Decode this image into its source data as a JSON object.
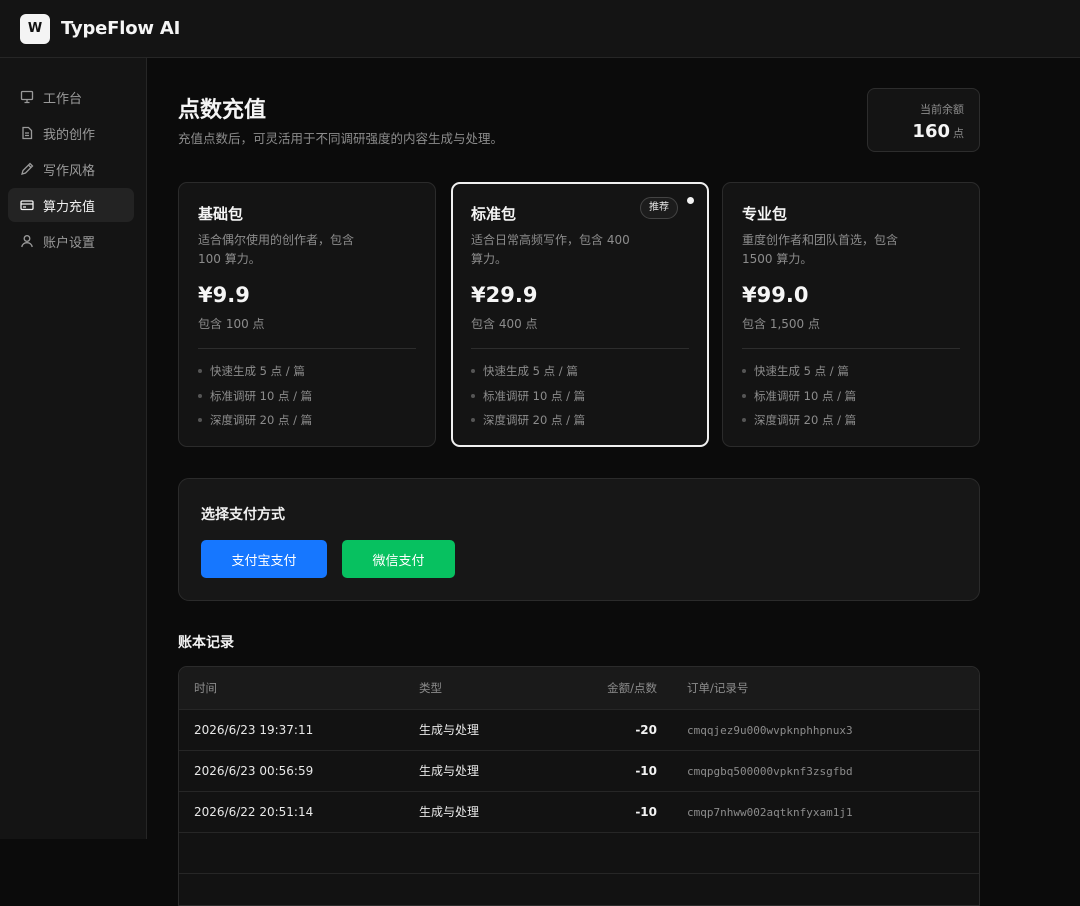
{
  "app": {
    "logo_letter": "W",
    "title": "TypeFlow AI"
  },
  "sidebar": {
    "items": [
      {
        "label": "工作台",
        "icon": "monitor-icon",
        "active": false
      },
      {
        "label": "我的创作",
        "icon": "document-icon",
        "active": false
      },
      {
        "label": "写作风格",
        "icon": "pen-icon",
        "active": false
      },
      {
        "label": "算力充值",
        "icon": "credit-card-icon",
        "active": true
      },
      {
        "label": "账户设置",
        "icon": "user-icon",
        "active": false
      }
    ]
  },
  "page": {
    "title": "点数充值",
    "subtitle": "充值点数后，可灵活用于不同调研强度的内容生成与处理。",
    "balance_label": "当前余额",
    "balance_value": "160",
    "balance_unit": "点"
  },
  "plans": [
    {
      "name": "基础包",
      "desc": "适合偶尔使用的创作者，包含 100 算力。",
      "price": "¥9.9",
      "points": "包含 100 点",
      "features": [
        "快速生成 5 点 / 篇",
        "标准调研 10 点 / 篇",
        "深度调研 20 点 / 篇"
      ]
    },
    {
      "name": "标准包",
      "desc": "适合日常高频写作，包含 400 算力。",
      "price": "¥29.9",
      "points": "包含 400 点",
      "badge": "推荐",
      "selected": true,
      "features": [
        "快速生成 5 点 / 篇",
        "标准调研 10 点 / 篇",
        "深度调研 20 点 / 篇"
      ]
    },
    {
      "name": "专业包",
      "desc": "重度创作者和团队首选，包含 1500 算力。",
      "price": "¥99.0",
      "points": "包含 1,500 点",
      "features": [
        "快速生成 5 点 / 篇",
        "标准调研 10 点 / 篇",
        "深度调研 20 点 / 篇"
      ]
    }
  ],
  "payment": {
    "title": "选择支付方式",
    "alipay_label": "支付宝支付",
    "wechat_label": "微信支付",
    "alipay_color": "#1677ff",
    "wechat_color": "#07c160"
  },
  "ledger": {
    "title": "账本记录",
    "columns": [
      "时间",
      "类型",
      "金额/点数",
      "订单/记录号"
    ],
    "rows": [
      {
        "time": "2026/6/23 19:37:11",
        "type": "生成与处理",
        "amount": "-20",
        "order": "cmqqjez9u000wvpknphhpnux3"
      },
      {
        "time": "2026/6/23 00:56:59",
        "type": "生成与处理",
        "amount": "-10",
        "order": "cmqpgbq500000vpknf3zsgfbd"
      },
      {
        "time": "2026/6/22 20:51:14",
        "type": "生成与处理",
        "amount": "-10",
        "order": "cmqp7nhww002aqtknfyxam1j1"
      }
    ]
  }
}
